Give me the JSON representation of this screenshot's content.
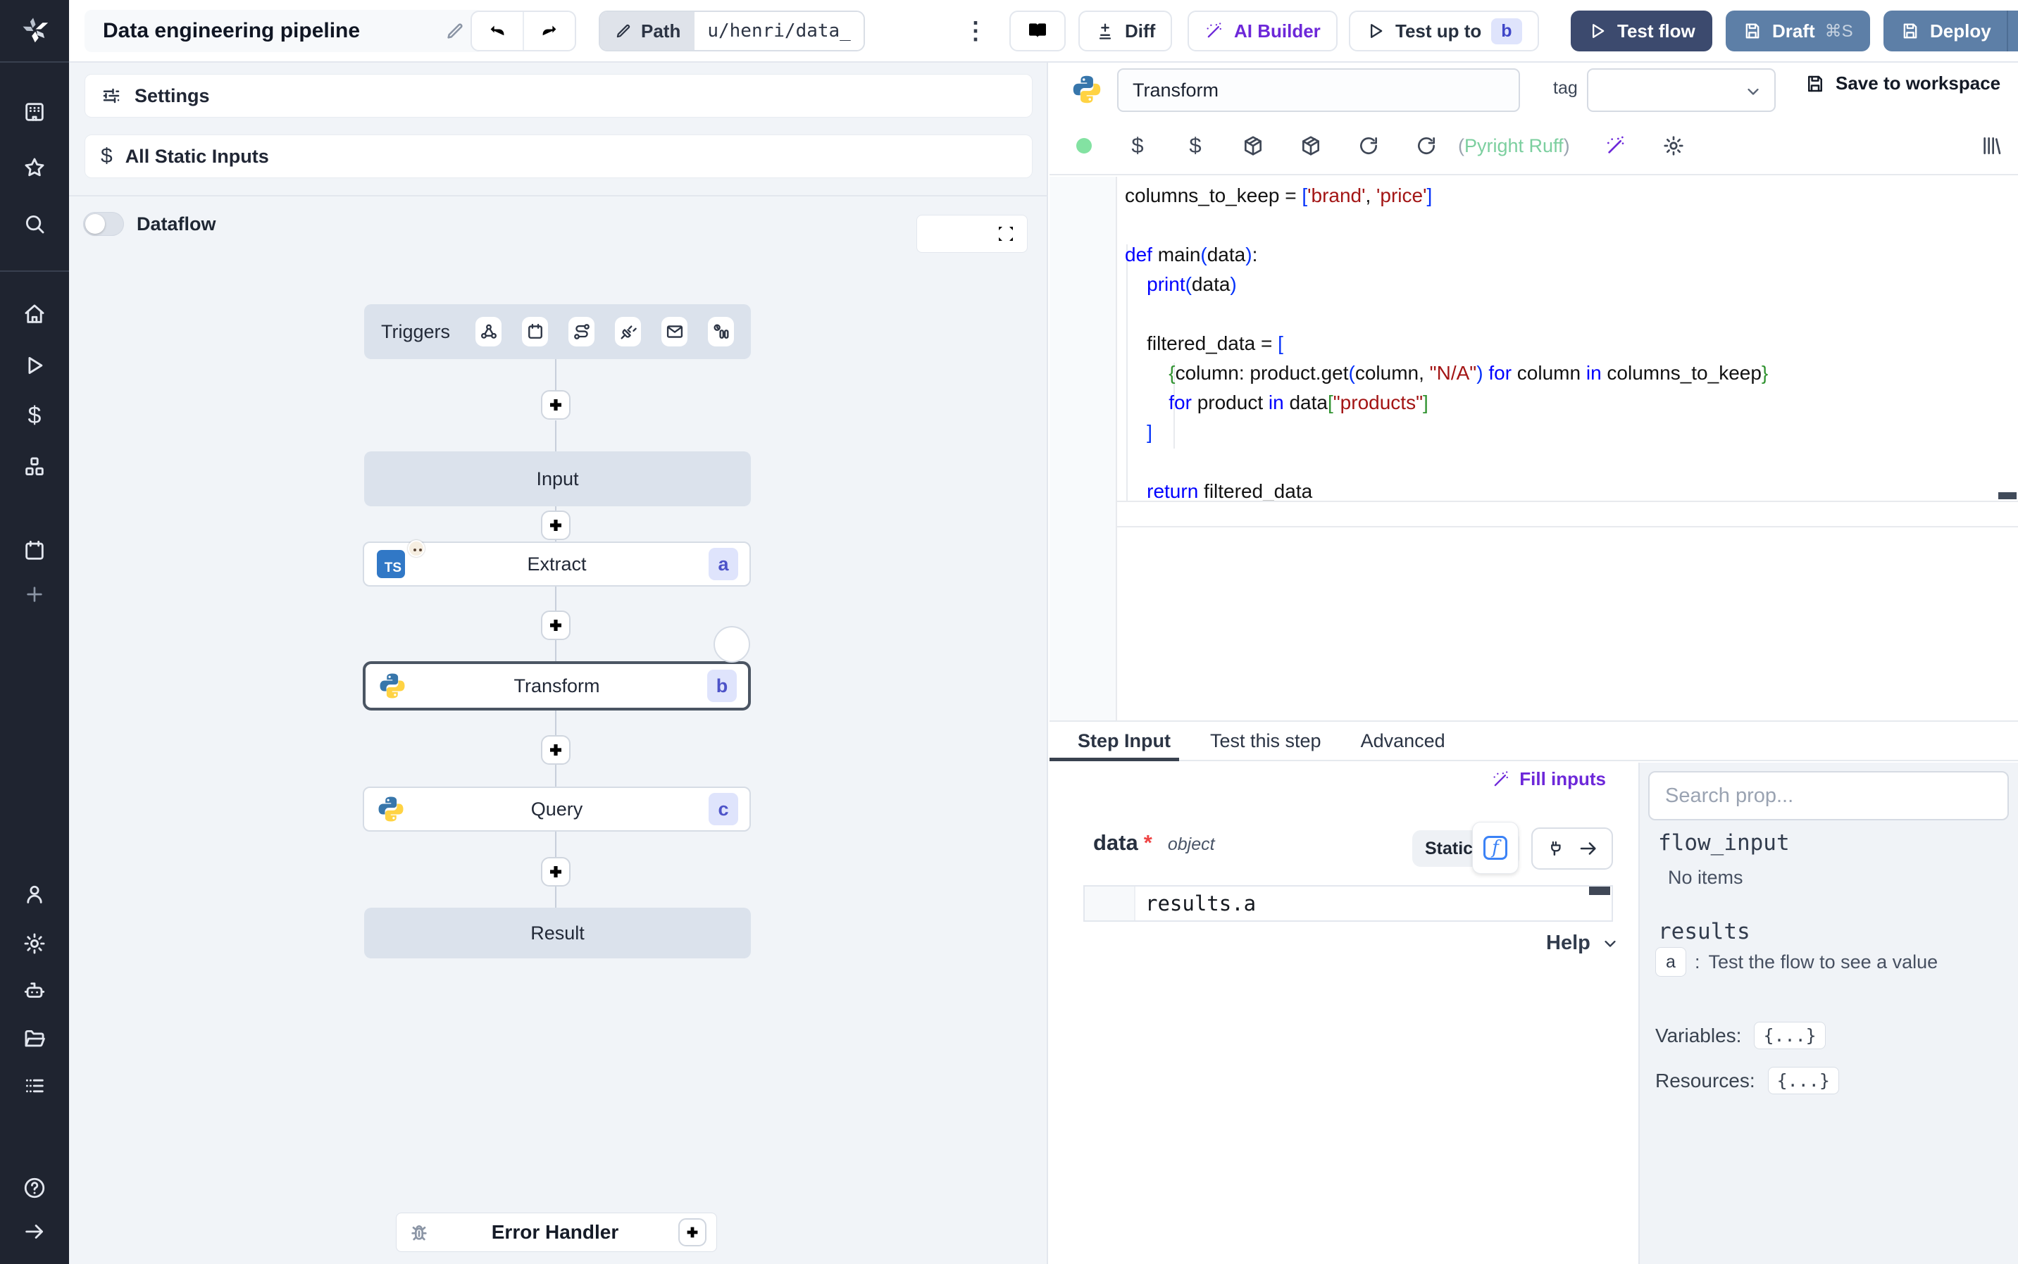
{
  "topbar": {
    "title": "Data engineering pipeline",
    "path_label": "Path",
    "path_value": "u/henri/data_",
    "diff": "Diff",
    "ai_builder": "AI Builder",
    "test_up_to": "Test up to",
    "test_up_to_badge": "b",
    "test_flow": "Test flow",
    "draft": "Draft",
    "draft_shortcut": "⌘S",
    "deploy": "Deploy"
  },
  "flow": {
    "settings": "Settings",
    "all_static_inputs": "All Static Inputs",
    "dataflow": "Dataflow",
    "triggers_label": "Triggers",
    "input_label": "Input",
    "extract_label": "Extract",
    "extract_badge": "a",
    "extract_lang": "TS",
    "transform_label": "Transform",
    "transform_badge": "b",
    "query_label": "Query",
    "query_badge": "c",
    "result_label": "Result",
    "error_handler_label": "Error Handler"
  },
  "editor": {
    "step_name": "Transform",
    "tag_label": "tag",
    "save_to_workspace": "Save to workspace",
    "lint_open": "(",
    "lint_text": "Pyright Ruff",
    "lint_close": ")"
  },
  "code": {
    "lines": [
      [
        [
          "columns_to_keep = ",
          "p"
        ],
        [
          "[",
          "b1"
        ],
        [
          "'brand'",
          "s"
        ],
        [
          ", ",
          "p"
        ],
        [
          "'price'",
          "s"
        ],
        [
          "]",
          "b1"
        ]
      ],
      [],
      [
        [
          "def ",
          "k"
        ],
        [
          "main",
          "p"
        ],
        [
          "(",
          "b1"
        ],
        [
          "data",
          "p"
        ],
        [
          ")",
          "b1"
        ],
        [
          ":",
          "p"
        ]
      ],
      [
        [
          "    ",
          "p"
        ],
        [
          "print",
          "k"
        ],
        [
          "(",
          "b1"
        ],
        [
          "data",
          "p"
        ],
        [
          ")",
          "b1"
        ]
      ],
      [],
      [
        [
          "    filtered_data = ",
          "p"
        ],
        [
          "[",
          "b1"
        ]
      ],
      [
        [
          "        ",
          "p"
        ],
        [
          "{",
          "b2"
        ],
        [
          "column: product.get",
          "p"
        ],
        [
          "(",
          "b1"
        ],
        [
          "column, ",
          "p"
        ],
        [
          "\"N/A\"",
          "s"
        ],
        [
          ")",
          "b1"
        ],
        [
          " ",
          "p"
        ],
        [
          "for",
          "k"
        ],
        [
          " column ",
          "p"
        ],
        [
          "in",
          "k"
        ],
        [
          " columns_to_keep",
          "p"
        ],
        [
          "}",
          "b2"
        ]
      ],
      [
        [
          "        ",
          "p"
        ],
        [
          "for",
          "k"
        ],
        [
          " product ",
          "p"
        ],
        [
          "in",
          "k"
        ],
        [
          " data",
          "p"
        ],
        [
          "[",
          "b2"
        ],
        [
          "\"products\"",
          "s"
        ],
        [
          "]",
          "b2"
        ]
      ],
      [
        [
          "    ",
          "p"
        ],
        [
          "]",
          "b1"
        ]
      ],
      [],
      [
        [
          "    ",
          "p"
        ],
        [
          "return",
          "k"
        ],
        [
          " filtered_data",
          "p"
        ]
      ]
    ]
  },
  "tabs": {
    "step_input": "Step Input",
    "test_this_step": "Test this step",
    "advanced": "Advanced"
  },
  "step_input": {
    "fill_inputs": "Fill inputs",
    "arg_name": "data",
    "arg_required": "*",
    "arg_type": "object",
    "static_label": "Static",
    "expr_value": "results.a",
    "help": "Help"
  },
  "props": {
    "search_placeholder": "Search prop...",
    "flow_input": "flow_input",
    "no_items": "No items",
    "results": "results",
    "result_key": "a",
    "result_colon": ":",
    "result_hint": "Test the flow to see a value",
    "variables_label": "Variables:",
    "variables_value": "{...}",
    "resources_label": "Resources:",
    "resources_value": "{...}"
  },
  "colors": {
    "sidebar_bg": "#1f2430",
    "canvas_bg": "#f1f4f8",
    "primary_dark_button": "#3c4a6e",
    "secondary_button": "#5d7fa7",
    "accent_purple": "#6d28d9",
    "badge_bg": "#dfe4fc",
    "badge_text": "#4d53c8",
    "lint_green": "#7ccf9f",
    "status_dot_green": "#83e2a2",
    "code_keyword": "#0000ff",
    "code_string": "#a31515"
  }
}
